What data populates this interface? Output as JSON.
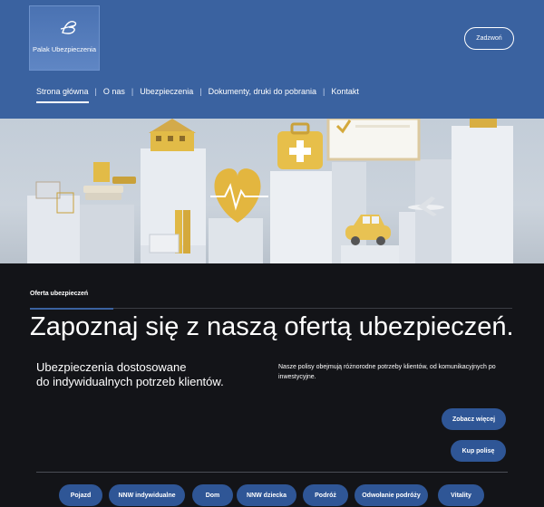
{
  "brand": {
    "name": "Palak Ubezpieczenia"
  },
  "header": {
    "cta_label": "Zadzwoń"
  },
  "nav": {
    "items": [
      {
        "label": "Strona główna",
        "active": true
      },
      {
        "label": "O nas"
      },
      {
        "label": "Ubezpieczenia"
      },
      {
        "label": "Dokumenty, druki do pobrania"
      },
      {
        "label": "Kontakt"
      }
    ]
  },
  "offer": {
    "kicker": "Oferta ubezpieczeń",
    "headline": "Zapoznaj się z naszą ofertą ubezpieczeń.",
    "subhead_line1": "Ubezpieczenia dostosowane",
    "subhead_line2": "do indywidualnych potrzeb klientów.",
    "description": "Nasze polisy obejmują różnorodne potrzeby klientów, od komunikacyjnych po inwestycyjne.",
    "more_label": "Zobacz więcej",
    "buy_label": "Kup polisę"
  },
  "categories": [
    "Pojazd",
    "NNW indywidualne",
    "Dom",
    "NNW dziecka",
    "Podróż",
    "Odwołanie podróży",
    "Vitality"
  ],
  "colors": {
    "header_bg": "#3a62a0",
    "button_bg": "#2f5696",
    "page_bg": "#131418"
  }
}
